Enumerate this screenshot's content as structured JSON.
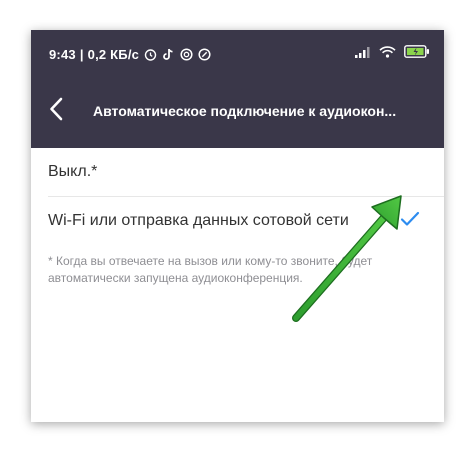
{
  "status_bar": {
    "time": "9:43",
    "speed": "0,2 КБ/с",
    "icons_left": [
      "alarm-icon",
      "tiktok-icon",
      "app-icon",
      "app-icon-2"
    ],
    "icons_right": [
      "signal-icon",
      "wifi-icon",
      "battery-charging-icon"
    ]
  },
  "toolbar": {
    "back_icon": "chevron-left-icon",
    "title": "Автоматическое подключение к аудиокон..."
  },
  "options": [
    {
      "label": "Выкл.*",
      "selected": false
    },
    {
      "label": "Wi-Fi или отправка данных сотовой сети",
      "selected": true
    }
  ],
  "footnote": "* Когда вы отвечаете на вызов или кому-то звоните, будет автоматически запущена аудиоконференция.",
  "colors": {
    "header": "#3a3749",
    "accent_check": "#2d8cf0",
    "annotation_arrow": "#3cb339"
  }
}
